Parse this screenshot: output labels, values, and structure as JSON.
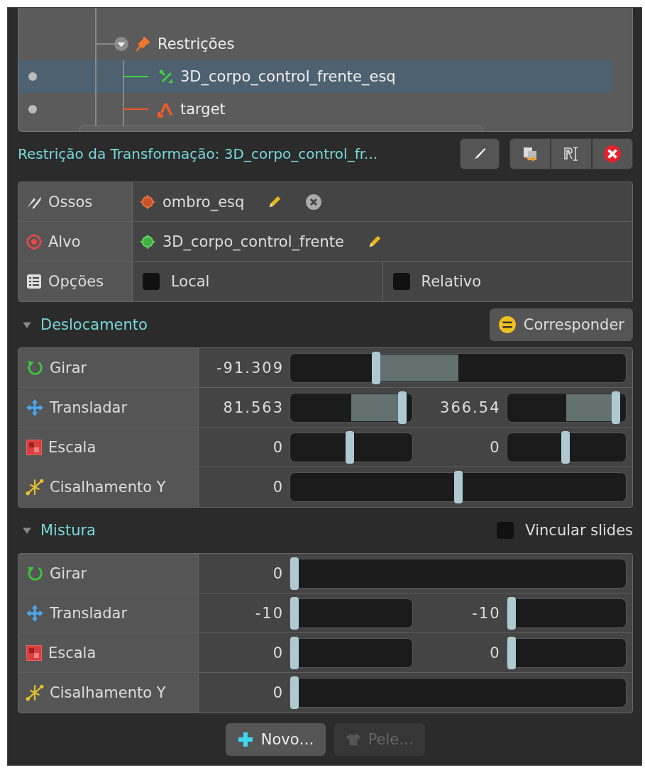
{
  "tree": {
    "items": [
      {
        "label": "Restrições",
        "expanded": true,
        "children": [
          {
            "label": "3D_corpo_control_frente_esq",
            "kind": "transform",
            "selected": true
          },
          {
            "label": "target",
            "kind": "target",
            "selected": false
          }
        ]
      }
    ]
  },
  "constraint": {
    "title": "Restrição da Transformação: 3D_corpo_control_fr..."
  },
  "properties": {
    "bones": {
      "label": "Ossos",
      "value": "ombro_esq"
    },
    "target": {
      "label": "Alvo",
      "value": "3D_corpo_control_frente"
    },
    "options": {
      "label": "Opções",
      "checks": [
        {
          "label": "Local",
          "checked": false
        },
        {
          "label": "Relativo",
          "checked": false
        }
      ]
    }
  },
  "sections": [
    {
      "title": "Deslocamento",
      "expanded": true,
      "kind": "offset",
      "action": "Corresponder",
      "rows": [
        {
          "label": "Girar",
          "kind": "rotate",
          "values": [
            {
              "reading": "-91.309",
              "level": 0.25
            }
          ]
        },
        {
          "label": "Transladar",
          "kind": "translate",
          "values": [
            {
              "reading": "81.563",
              "level": 0.95
            },
            {
              "reading": "366.54",
              "level": 0.95
            }
          ]
        },
        {
          "label": "Escala",
          "kind": "scale",
          "values": [
            {
              "reading": "0",
              "level": 0.49
            },
            {
              "reading": "0",
              "level": 0.49
            }
          ]
        },
        {
          "label": "Cisalhamento Y",
          "kind": "shear",
          "values": [
            {
              "reading": "0",
              "level": 0.5
            }
          ]
        }
      ]
    },
    {
      "title": "Mistura",
      "expanded": true,
      "kind": "mix",
      "link": {
        "label": "Vincular slides",
        "checked": false
      },
      "rows": [
        {
          "label": "Girar",
          "kind": "rotate",
          "values": [
            {
              "reading": "0",
              "level": 0
            }
          ]
        },
        {
          "label": "Transladar",
          "kind": "translate",
          "values": [
            {
              "reading": "-10",
              "level": 0
            },
            {
              "reading": "-10",
              "level": 0
            }
          ]
        },
        {
          "label": "Escala",
          "kind": "scale",
          "values": [
            {
              "reading": "0",
              "level": 0
            },
            {
              "reading": "0",
              "level": 0
            }
          ]
        },
        {
          "label": "Cisalhamento Y",
          "kind": "shear",
          "values": [
            {
              "reading": "0",
              "level": 0
            }
          ]
        }
      ]
    }
  ],
  "buttons": [
    {
      "label": "Novo…",
      "kind": "new",
      "disabled": false
    },
    {
      "label": "Pele…",
      "kind": "skin",
      "disabled": true
    }
  ]
}
